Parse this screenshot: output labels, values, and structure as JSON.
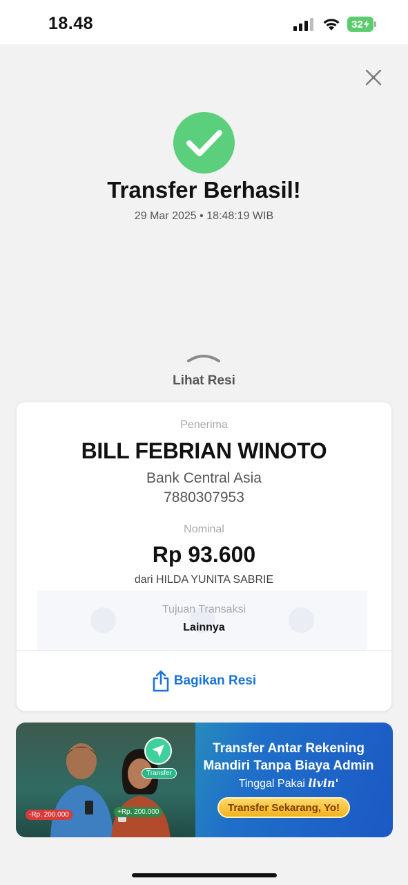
{
  "status_bar": {
    "time": "18.48",
    "battery": "32"
  },
  "icons": {
    "close": "close-icon",
    "success": "checkmark-icon",
    "chevron": "chevron-up-icon",
    "share": "share-icon",
    "transfer": "send-arrow-icon"
  },
  "header": {
    "title": "Transfer Berhasil!",
    "datetime": "29 Mar 2025 • 18:48:19 WIB"
  },
  "toggle": {
    "label": "Lihat Resi"
  },
  "receipt": {
    "recipient_label": "Penerima",
    "recipient_name": "BILL FEBRIAN WINOTO",
    "bank": "Bank Central Asia",
    "account_number": "7880307953",
    "amount_label": "Nominal",
    "amount": "Rp 93.600",
    "sender": "dari HILDA YUNITA SABRIE",
    "purpose_label": "Tujuan Transaksi",
    "purpose": "Lainnya",
    "share_label": "Bagikan Resi"
  },
  "promo": {
    "badge_minus": "-Rp. 200.000",
    "badge_plus": "+Rp. 200.000",
    "transfer_chip": "Transfer",
    "headline_1": "Transfer Antar Rekening",
    "headline_2": "Mandiri Tanpa Biaya Admin",
    "sub_prefix": "Tinggal Pakai",
    "sub_brand": "livin'",
    "cta": "Transfer Sekarang, Yo!"
  },
  "colors": {
    "success_green": "#5bcf7c",
    "link_blue": "#1a73d9",
    "battery_green": "#5ccc6e"
  }
}
